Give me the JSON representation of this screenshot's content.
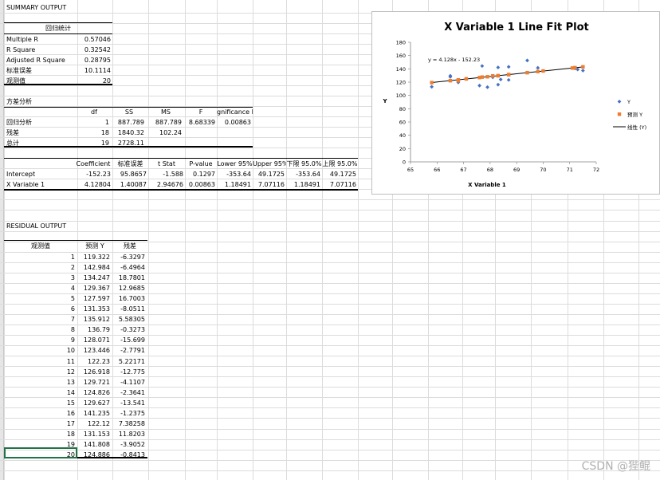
{
  "summary": {
    "title": "SUMMARY OUTPUT",
    "regression_header": "回归统计",
    "stats": [
      {
        "label": "Multiple R",
        "value": "0.57046"
      },
      {
        "label": "R Square",
        "value": "0.32542"
      },
      {
        "label": "Adjusted R Square",
        "value": "0.28795"
      },
      {
        "label": "标准误差",
        "value": "10.1114"
      },
      {
        "label": "观测值",
        "value": "20"
      }
    ]
  },
  "anova": {
    "title": "方差分析",
    "headers": [
      "df",
      "SS",
      "MS",
      "F",
      "gnificance F"
    ],
    "rows": [
      {
        "label": "回归分析",
        "df": "1",
        "ss": "887.789",
        "ms": "887.789",
        "f": "8.68339",
        "sig": "0.00863"
      },
      {
        "label": "残差",
        "df": "18",
        "ss": "1840.32",
        "ms": "102.24",
        "f": "",
        "sig": ""
      },
      {
        "label": "总计",
        "df": "19",
        "ss": "2728.11",
        "ms": "",
        "f": "",
        "sig": ""
      }
    ]
  },
  "coef": {
    "headers": [
      "Coefficient",
      "标准误差",
      "t Stat",
      "P-value",
      "Lower 95%",
      "Upper 95%",
      "下限 95.0%",
      "上限 95.0%"
    ],
    "rows": [
      {
        "label": "Intercept",
        "values": [
          "-152.23",
          "95.8657",
          "-1.588",
          "0.1297",
          "-353.64",
          "49.1725",
          "-353.64",
          "49.1725"
        ]
      },
      {
        "label": "X Variable 1",
        "values": [
          "4.12804",
          "1.40087",
          "2.94676",
          "0.00863",
          "1.18491",
          "7.07116",
          "1.18491",
          "7.07116"
        ]
      }
    ]
  },
  "residual": {
    "title": "RESIDUAL OUTPUT",
    "headers": [
      "观测值",
      "预测 Y",
      "残差"
    ],
    "rows": [
      [
        "1",
        "119.322",
        "-6.3297"
      ],
      [
        "2",
        "142.984",
        "-6.4964"
      ],
      [
        "3",
        "134.247",
        "18.7801"
      ],
      [
        "4",
        "129.367",
        "12.9685"
      ],
      [
        "5",
        "127.597",
        "16.7003"
      ],
      [
        "6",
        "131.353",
        "-8.0511"
      ],
      [
        "7",
        "135.912",
        "5.58305"
      ],
      [
        "8",
        "136.79",
        "-0.3273"
      ],
      [
        "9",
        "128.071",
        "-15.699"
      ],
      [
        "10",
        "123.446",
        "-2.7791"
      ],
      [
        "11",
        "122.23",
        "5.22171"
      ],
      [
        "12",
        "126.918",
        "-12.775"
      ],
      [
        "13",
        "129.721",
        "-4.1107"
      ],
      [
        "14",
        "124.826",
        "-2.3641"
      ],
      [
        "15",
        "129.627",
        "-13.541"
      ],
      [
        "16",
        "141.235",
        "-1.2375"
      ],
      [
        "17",
        "122.12",
        "7.38258"
      ],
      [
        "18",
        "131.153",
        "11.8203"
      ],
      [
        "19",
        "141.808",
        "-3.9052"
      ],
      [
        "20",
        "124.886",
        "-0.8413"
      ]
    ]
  },
  "chart_data": {
    "type": "scatter",
    "title": "X Variable 1 Line Fit  Plot",
    "xlabel": "X Variable 1",
    "ylabel": "Y",
    "xlim": [
      65,
      72
    ],
    "ylim": [
      0,
      180
    ],
    "xticks": [
      "65",
      "66",
      "67",
      "68",
      "69",
      "70",
      "71",
      "72"
    ],
    "yticks": [
      "0",
      "20",
      "40",
      "60",
      "80",
      "100",
      "120",
      "140",
      "160",
      "180"
    ],
    "equation": "y = 4.128x - 152.23",
    "legend_position": "right",
    "colors": {
      "y": "#4472C4",
      "pred": "#ED7D31",
      "trend": "#000000"
    },
    "series": [
      {
        "name": "Y",
        "marker": "diamond",
        "points": [
          [
            65.8,
            113.0
          ],
          [
            66.5,
            129.5
          ],
          [
            66.5,
            128.0
          ],
          [
            66.8,
            119.6
          ],
          [
            66.8,
            122.9
          ],
          [
            67.1,
            124.8
          ],
          [
            67.6,
            114.8
          ],
          [
            67.7,
            144.3
          ],
          [
            67.9,
            112.4
          ],
          [
            68.1,
            127.3
          ],
          [
            68.3,
            142.1
          ],
          [
            68.3,
            116.2
          ],
          [
            68.4,
            124.0
          ],
          [
            68.7,
            143.0
          ],
          [
            68.7,
            123.3
          ],
          [
            69.4,
            152.6
          ],
          [
            69.8,
            141.5
          ],
          [
            71.2,
            140.6
          ],
          [
            71.3,
            139.1
          ],
          [
            71.5,
            137.4
          ]
        ]
      },
      {
        "name": "预测 Y",
        "marker": "square",
        "points": [
          [
            65.8,
            119.3
          ],
          [
            66.5,
            122.2
          ],
          [
            66.8,
            122.1
          ],
          [
            66.8,
            123.4
          ],
          [
            67.1,
            124.9
          ],
          [
            67.6,
            126.9
          ],
          [
            67.7,
            127.6
          ],
          [
            67.9,
            128.1
          ],
          [
            68.1,
            129.4
          ],
          [
            68.3,
            129.7
          ],
          [
            68.3,
            129.6
          ],
          [
            68.7,
            131.4
          ],
          [
            68.7,
            131.2
          ],
          [
            69.4,
            134.2
          ],
          [
            69.8,
            135.9
          ],
          [
            70.0,
            136.8
          ],
          [
            71.1,
            141.2
          ],
          [
            71.2,
            141.8
          ],
          [
            71.5,
            143.0
          ]
        ]
      }
    ],
    "trendline_label": "线性 (Y)"
  },
  "watermark": "CSDN @狴鲲"
}
